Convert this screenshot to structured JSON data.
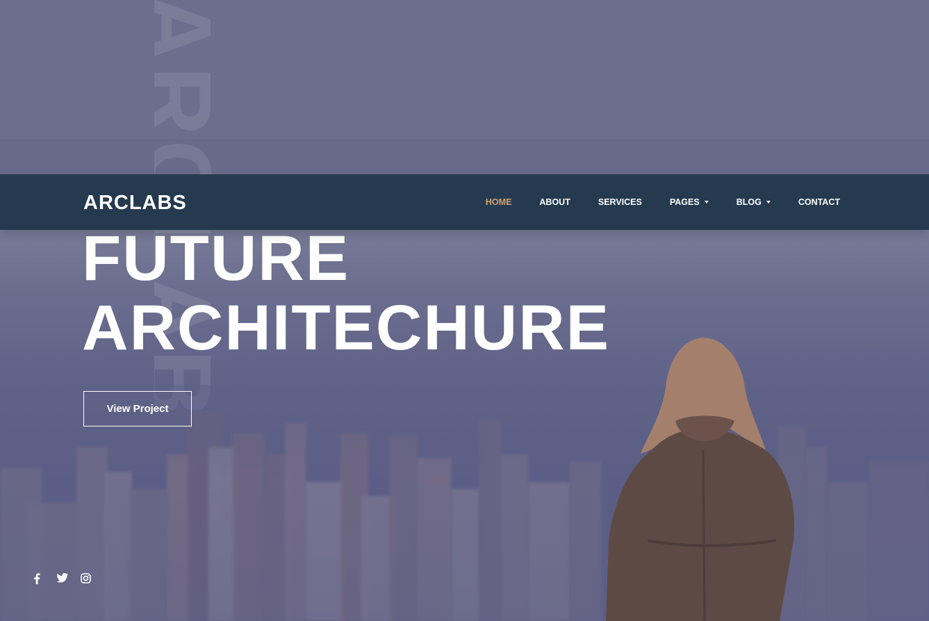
{
  "brand": {
    "name": "ARCLABS"
  },
  "watermark": {
    "text": "ARCLABS"
  },
  "nav": {
    "items": [
      {
        "label": "HOME",
        "active": true,
        "dropdown": false
      },
      {
        "label": "ABOUT",
        "active": false,
        "dropdown": false
      },
      {
        "label": "SERVICES",
        "active": false,
        "dropdown": false
      },
      {
        "label": "PAGES",
        "active": false,
        "dropdown": true
      },
      {
        "label": "BLOG",
        "active": false,
        "dropdown": true
      },
      {
        "label": "CONTACT",
        "active": false,
        "dropdown": false
      }
    ],
    "active_color": "#d4a373",
    "background": "#253a4f"
  },
  "hero": {
    "title_line1": "FUTURE",
    "title_line2": "ARCHITECHURE",
    "cta_label": "View Project"
  },
  "social": {
    "icons": [
      "facebook-icon",
      "twitter-icon",
      "instagram-icon"
    ]
  }
}
